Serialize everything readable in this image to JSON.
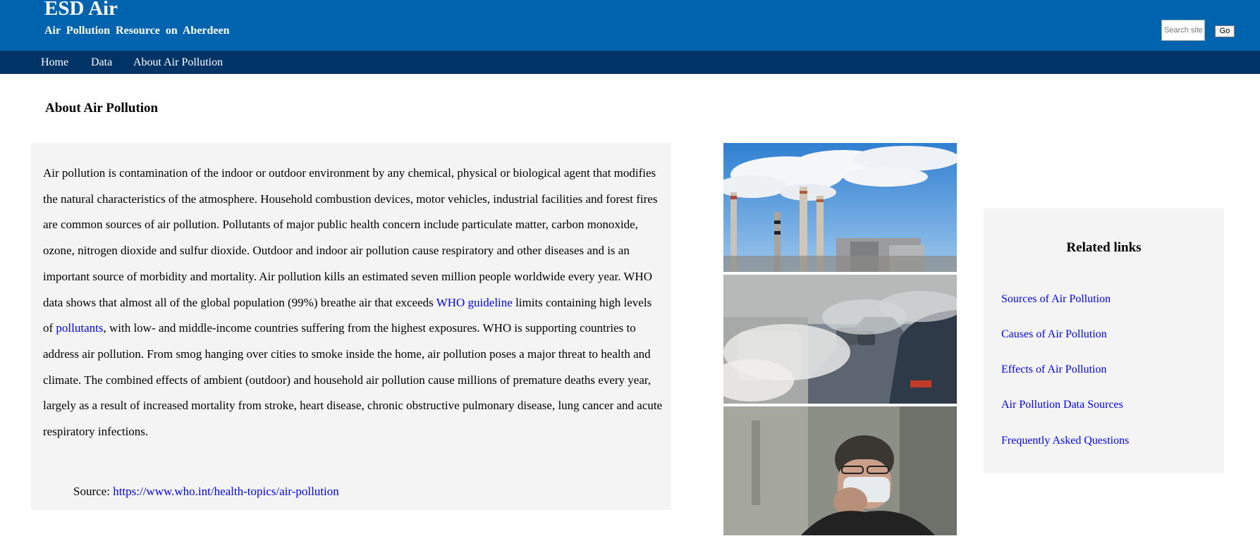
{
  "header": {
    "title": "ESD Air",
    "subtitle": "Air Pollution Resource on Aberdeen",
    "search_placeholder": "Search site",
    "search_button": "Go",
    "bg_color": "#0063ad"
  },
  "nav": {
    "items": [
      "Home",
      "Data",
      "About Air Pollution"
    ],
    "bg_color": "#003466"
  },
  "main": {
    "page_title": "About Air Pollution",
    "article": {
      "text_1": "Air pollution is contamination of the indoor or outdoor environment by any chemical, physical or biological agent that modifies the natural characteristics of the atmosphere. Household combustion devices, motor vehicles, industrial facilities and forest fires are common sources of air pollution. Pollutants of major public health concern include particulate matter, carbon monoxide, ozone, nitrogen dioxide and sulfur dioxide. Outdoor and indoor air pollution cause respiratory and other diseases and is an important source of morbidity and mortality. Air pollution kills an estimated seven million people worldwide every year. WHO data shows that almost all of the global population (99%) breathe air that exceeds ",
      "link_1": "WHO guideline",
      "text_2": " limits containing high levels of ",
      "link_2": "pollutants",
      "text_3": ", with low- and middle-income countries suffering from the highest exposures. WHO is supporting countries to address air pollution. From smog hanging over cities to smoke inside the home, air pollution poses a major threat to health and climate. The combined effects of ambient (outdoor) and household air pollution cause millions of premature deaths every year, largely as a result of increased mortality from stroke, heart disease, chronic obstructive pulmonary disease, lung cancer and acute respiratory infections."
    },
    "source_label": "Source: ",
    "source_url": "https://www.who.int/health-topics/air-pollution",
    "link_color": "#0000ee",
    "panel_color": "#f4f4f4"
  },
  "images": [
    "factory-smokestacks-image",
    "traffic-exhaust-image",
    "man-wearing-mask-image"
  ],
  "related": {
    "title": "Related links",
    "links": [
      "Sources of Air Pollution",
      "Causes of Air Pollution",
      "Effects of Air Pollution",
      "Air Pollution Data Sources",
      "Frequently Asked Questions"
    ]
  }
}
